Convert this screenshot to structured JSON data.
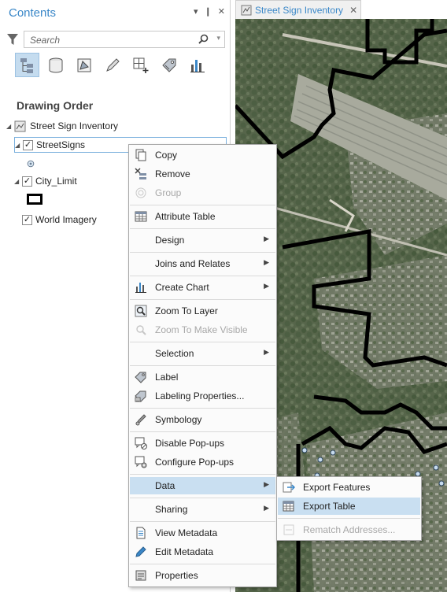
{
  "pane": {
    "title": "Contents",
    "controls": [
      "▾",
      "❙",
      "✕"
    ],
    "search_placeholder": "Search",
    "section_title": "Drawing Order",
    "view_buttons": [
      "list-by-drawing-order",
      "list-by-data-source",
      "list-by-selection",
      "list-by-editing",
      "list-by-snapping",
      "list-by-labeling",
      "list-by-charts"
    ]
  },
  "layers": {
    "map_name": "Street Sign Inventory",
    "items": [
      {
        "name": "StreetSigns",
        "checked": true
      },
      {
        "name": "City_Limit",
        "checked": true
      },
      {
        "name": "World Imagery",
        "checked": true
      }
    ]
  },
  "map_tab": {
    "label": "Street Sign Inventory",
    "close": "✕"
  },
  "context_menu": {
    "copy": "Copy",
    "remove": "Remove",
    "group": "Group",
    "attribute_table": "Attribute Table",
    "design": "Design",
    "joins_and_relates": "Joins and Relates",
    "create_chart": "Create Chart",
    "zoom_to_layer": "Zoom To Layer",
    "zoom_to_make_visible": "Zoom To Make Visible",
    "selection": "Selection",
    "label": "Label",
    "labeling_properties": "Labeling Properties...",
    "symbology": "Symbology",
    "disable_popups": "Disable Pop-ups",
    "configure_popups": "Configure Pop-ups",
    "data": "Data",
    "sharing": "Sharing",
    "view_metadata": "View Metadata",
    "edit_metadata": "Edit Metadata",
    "properties": "Properties"
  },
  "submenu": {
    "export_features": "Export Features",
    "export_table": "Export Table",
    "rematch_addresses": "Rematch Addresses..."
  },
  "colors": {
    "accent": "#3a87c8",
    "highlight": "#c9dff1",
    "boundary": "#000000"
  }
}
